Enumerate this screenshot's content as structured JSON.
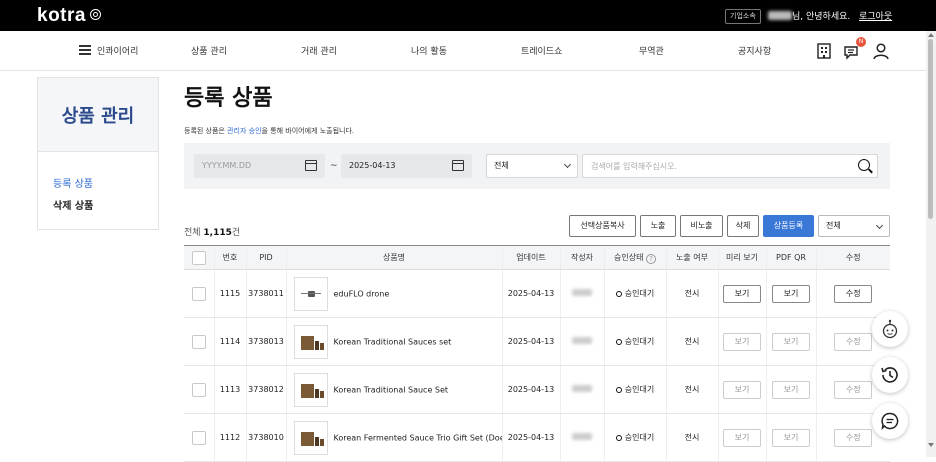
{
  "topbar": {
    "logo": "kotra",
    "corp_button": "기업소속",
    "greeting": "님, 안녕하세요.",
    "logout": "로그아웃"
  },
  "nav": {
    "menu_label": "인콰이어리",
    "items": [
      "상품 관리",
      "거래 관리",
      "나의 활동",
      "트레이드쇼",
      "무역관",
      "공지사항"
    ],
    "badge_count": "N"
  },
  "sidebar": {
    "title": "상품 관리",
    "links": [
      "등록 상품",
      "삭제 상품"
    ]
  },
  "page": {
    "title": "등록 상품",
    "note_prefix": "등록된 상품은 ",
    "note_link": "관리자 승인",
    "note_suffix": "을 통해 바이어에게 노출됩니다."
  },
  "filter": {
    "date_from_placeholder": "YYYY.MM.DD",
    "tilde": "~",
    "date_to": "2025-04-13",
    "scope": "전체",
    "search_placeholder": "검색어를 입력해주십시오."
  },
  "toolbar": {
    "total_prefix": "전체 ",
    "total_count": "1,115",
    "total_suffix": "건",
    "copy_button": "선택상품복사",
    "expose_button": "노출",
    "hide_button": "비노출",
    "delete_button": "삭제",
    "register_button": "상품등록",
    "status_select": "전체"
  },
  "table": {
    "headers": [
      "번호",
      "PID",
      "상품명",
      "업데이트",
      "작성자",
      "승인상태",
      "노출 여부",
      "미리 보기",
      "PDF QR",
      "수정"
    ],
    "rows": [
      {
        "no": "1115",
        "pid": "3738011",
        "name": "eduFLO drone",
        "updated": "2025-04-13",
        "status": "승인대기",
        "exposure": "전시",
        "preview": "보기",
        "qr": "보기",
        "edit": "수정"
      },
      {
        "no": "1114",
        "pid": "3738013",
        "name": "Korean Traditional Sauces set",
        "updated": "2025-04-13",
        "status": "승인대기",
        "exposure": "전시",
        "preview": "보기",
        "qr": "보기",
        "edit": "수정"
      },
      {
        "no": "1113",
        "pid": "3738012",
        "name": "Korean Traditional Sauce Set",
        "updated": "2025-04-13",
        "status": "승인대기",
        "exposure": "전시",
        "preview": "보기",
        "qr": "보기",
        "edit": "수정"
      },
      {
        "no": "1112",
        "pid": "3738010",
        "name": "Korean Fermented Sauce Trio Gift Set (Doen...",
        "updated": "2025-04-13",
        "status": "승인대기",
        "exposure": "전시",
        "preview": "보기",
        "qr": "보기",
        "edit": "수정"
      }
    ]
  },
  "icons": [
    "menu-icon",
    "building-icon",
    "chat-icon",
    "user-icon",
    "calendar-icon",
    "search-icon",
    "chevron-down-icon",
    "help-icon",
    "chatbot-icon",
    "history-icon",
    "message-icon"
  ]
}
